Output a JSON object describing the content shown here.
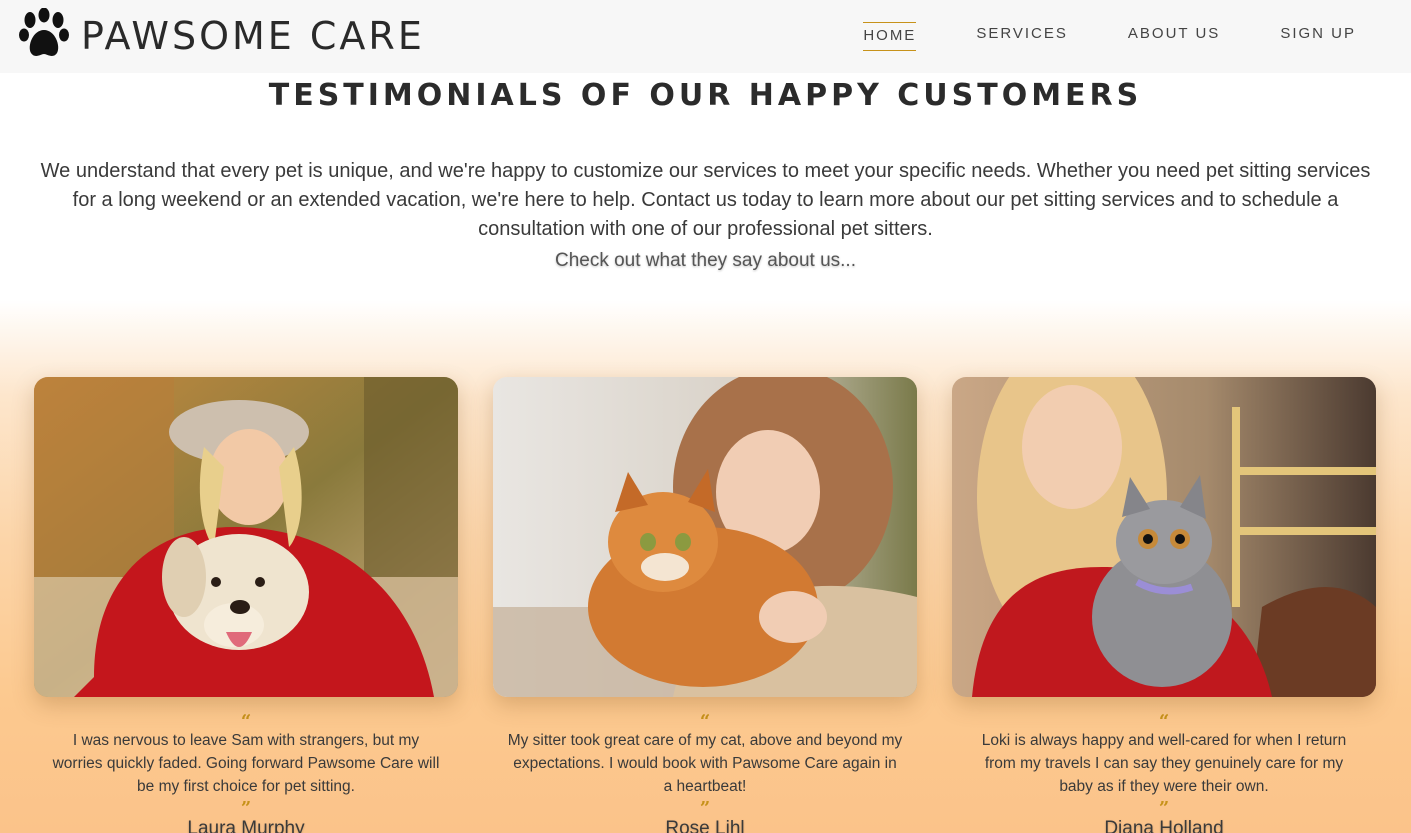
{
  "brand": {
    "name": "PAWSOME CARE",
    "logo_icon": "paw-icon"
  },
  "nav": {
    "items": [
      {
        "label": "HOME",
        "active": true
      },
      {
        "label": "SERVICES",
        "active": false
      },
      {
        "label": "ABOUT US",
        "active": false
      },
      {
        "label": "SIGN UP",
        "active": false
      }
    ]
  },
  "section": {
    "title": "TESTIMONIALS OF OUR HAPPY CUSTOMERS",
    "intro": "We understand that every pet is unique, and we're happy to customize our services to meet your specific needs. Whether you need pet sitting services for a long weekend or an extended vacation, we're here to help. Contact us today to learn more about our pet sitting services and to schedule a consultation with one of our professional pet sitters.",
    "tagline": "Check out what they say about us..."
  },
  "testimonials": [
    {
      "quote": "I was nervous to leave Sam with strangers, but my worries quickly faded. Going forward Pawsome Care will be my first choice for pet sitting.",
      "author": "Laura Murphy",
      "photo": "woman-with-dog-photo"
    },
    {
      "quote": "My sitter took great care of my cat, above and beyond my expectations. I would book with Pawsome Care again in a heartbeat!",
      "author": "Rose Lihl",
      "photo": "woman-with-orange-cat-photo"
    },
    {
      "quote": "Loki is always happy and well-cared for when I return from my travels I can say they genuinely care for my baby as if they were their own.",
      "author": "Diana Holland",
      "photo": "woman-with-grey-kitten-photo"
    }
  ],
  "quote_marks": {
    "open": "“",
    "close": "”"
  },
  "colors": {
    "accent": "#c7921a",
    "gradient_bottom": "#fbc38a",
    "nav_bg": "#f7f7f7"
  }
}
